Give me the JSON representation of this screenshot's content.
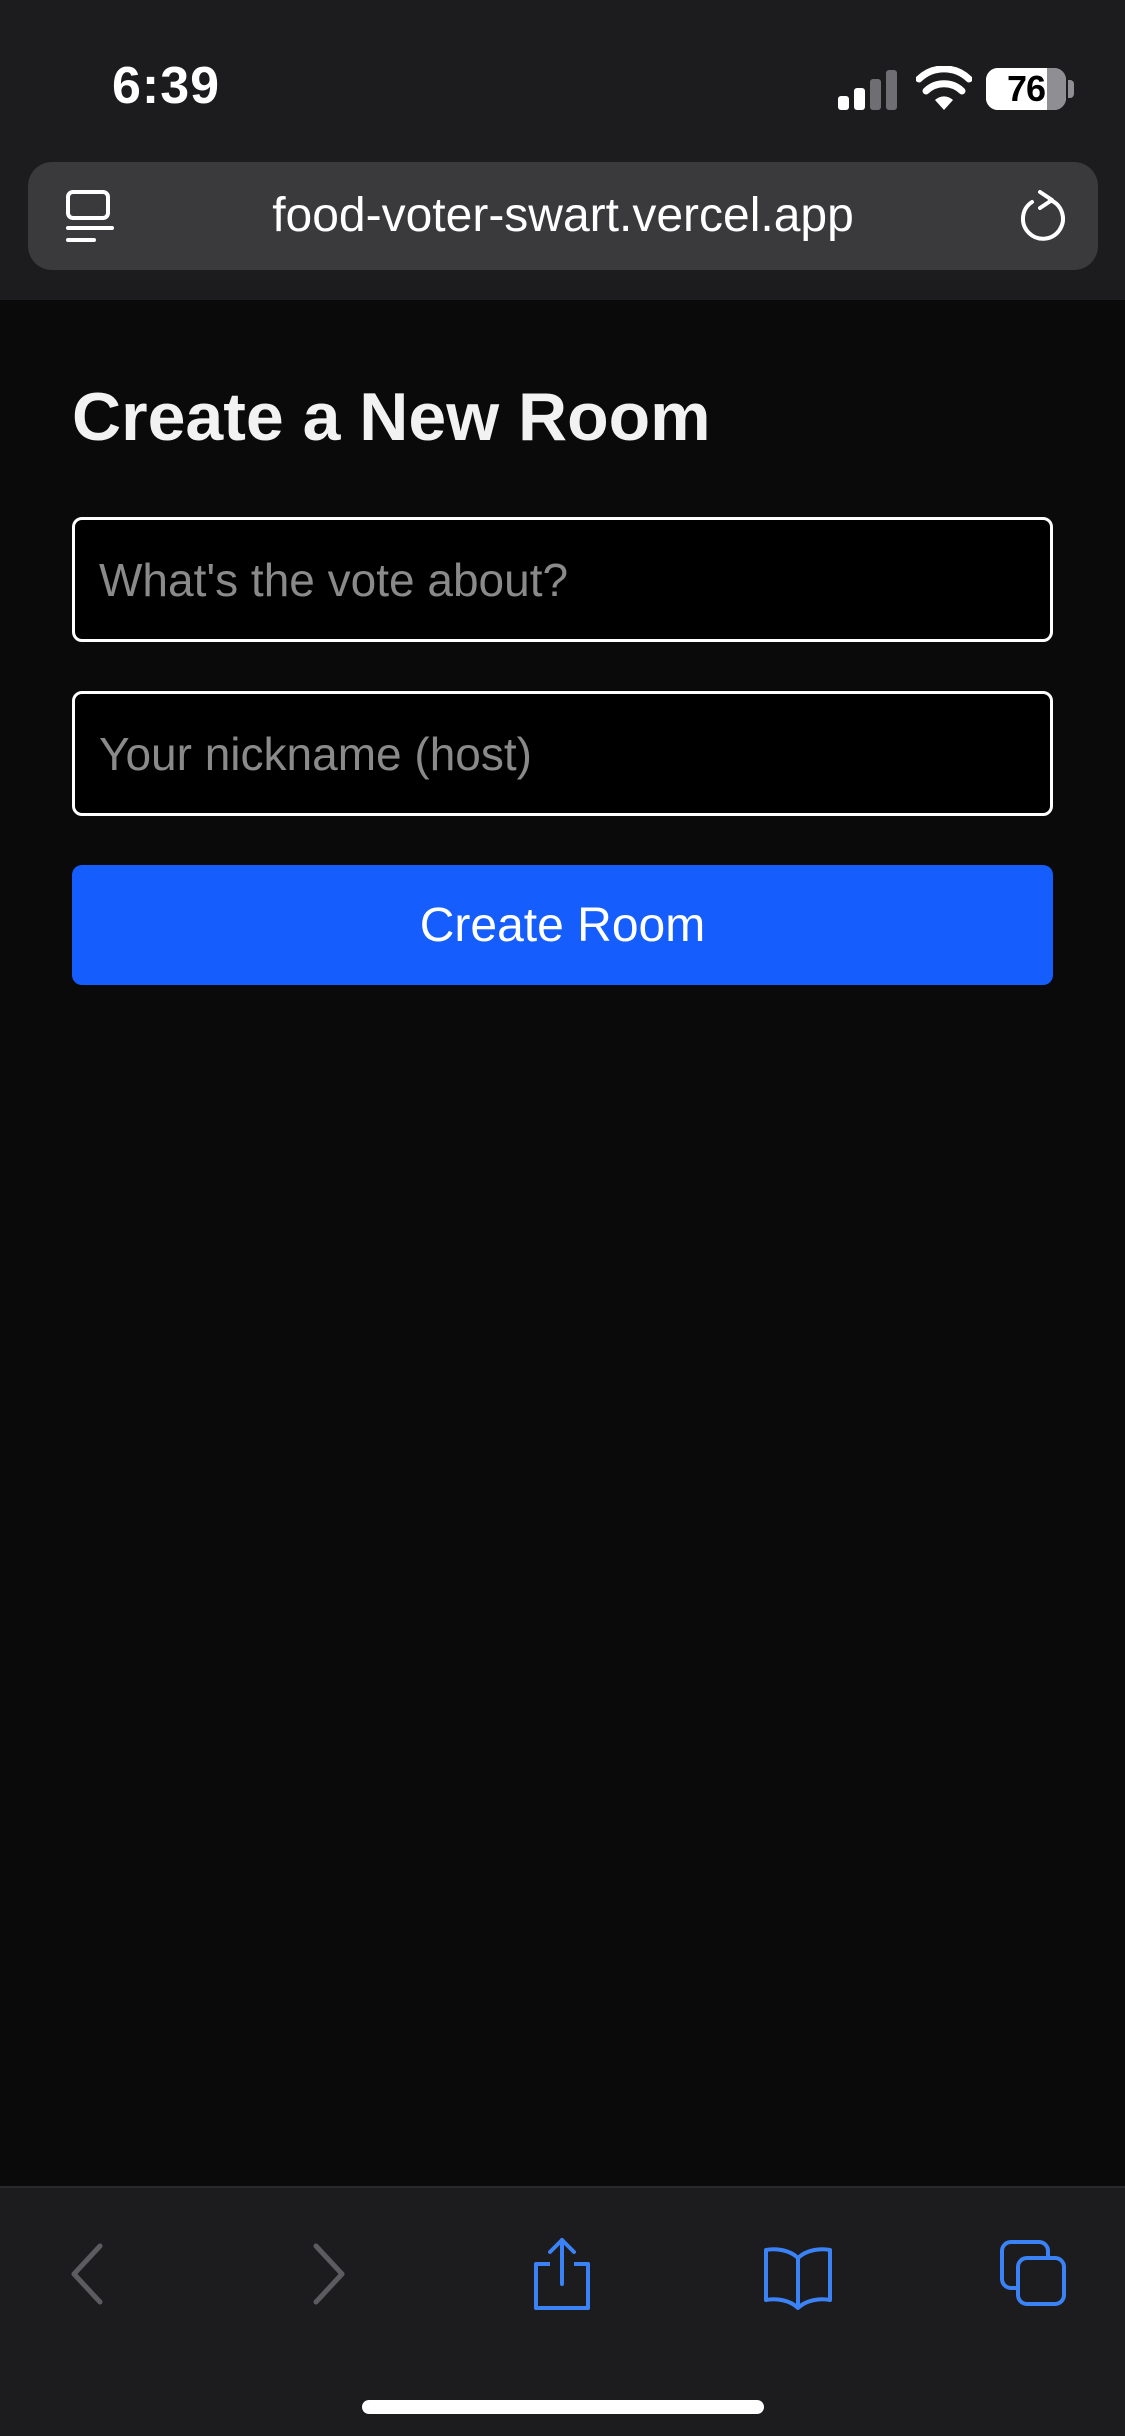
{
  "status_bar": {
    "time": "6:39",
    "battery_level": "76",
    "battery_percent": 76,
    "signal_bars_active": 2,
    "signal_bars_total": 4,
    "icons": [
      "signal-icon",
      "wifi-icon",
      "battery-icon"
    ]
  },
  "browser": {
    "url": "food-voter-swart.vercel.app",
    "icons": [
      "tab-overview-icon",
      "reload-icon"
    ],
    "toolbar_icons": [
      "back-icon",
      "forward-icon",
      "share-icon",
      "bookmarks-icon",
      "tabs-icon"
    ],
    "accent_color": "#3b82f6"
  },
  "page": {
    "title": "Create a New Room",
    "topic_field": {
      "placeholder": "What's the vote about?",
      "value": ""
    },
    "nickname_field": {
      "placeholder": "Your nickname (host)",
      "value": ""
    },
    "create_button": {
      "label": "Create Room",
      "color": "#155dfc"
    }
  }
}
